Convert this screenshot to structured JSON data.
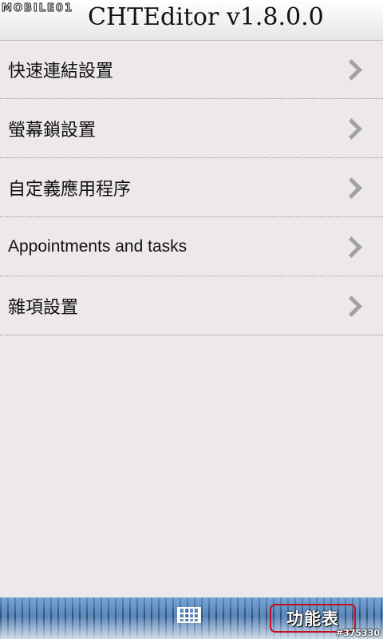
{
  "header": {
    "watermark": "MOBILE01",
    "title": "CHTEditor v1.8.0.0"
  },
  "menu": {
    "items": [
      {
        "label": "快速連結設置"
      },
      {
        "label": "螢幕鎖設置"
      },
      {
        "label": "自定義應用程序"
      },
      {
        "label": "Appointments and tasks"
      },
      {
        "label": "雜項設置"
      }
    ]
  },
  "bottom_bar": {
    "keyboard_icon": "keyboard-icon",
    "menu_label": "功能表",
    "post_id": "#375330"
  },
  "colors": {
    "background": "#ece8ec",
    "chevron": "#a2a2a2",
    "highlight_border": "#c01020"
  }
}
